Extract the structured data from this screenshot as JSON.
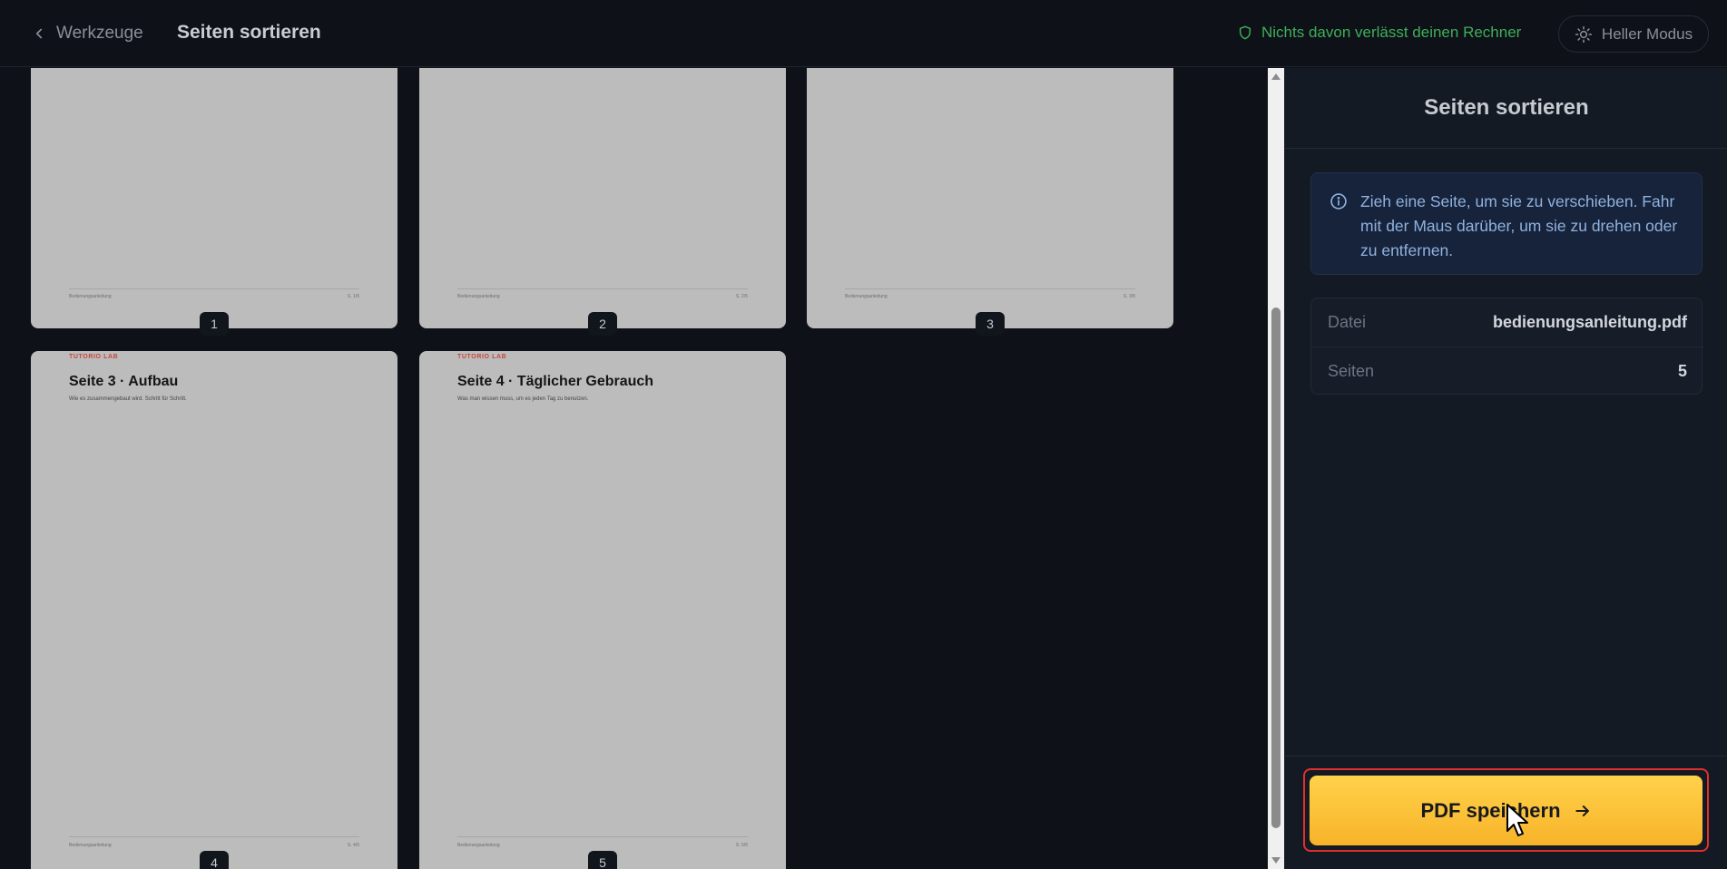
{
  "header": {
    "back_label": "Werkzeuge",
    "title": "Seiten sortieren",
    "privacy_text": "Nichts davon verlässt deinen Rechner",
    "theme_label": "Heller Modus"
  },
  "pages": [
    {
      "number": "1",
      "footer_left": "Bedienungsanleitung",
      "footer_right": "S. 1/5"
    },
    {
      "number": "2",
      "footer_left": "Bedienungsanleitung",
      "footer_right": "S. 2/5"
    },
    {
      "number": "3",
      "footer_left": "Bedienungsanleitung",
      "footer_right": "S. 3/5"
    },
    {
      "number": "4",
      "brand": "TUTORIO LAB",
      "heading": "Seite 3 · Aufbau",
      "subtitle": "Wie es zusammengebaut wird. Schritt für Schritt.",
      "footer_left": "Bedienungsanleitung",
      "footer_right": "S. 4/5"
    },
    {
      "number": "5",
      "brand": "TUTORIO LAB",
      "heading": "Seite 4 · Täglicher Gebrauch",
      "subtitle": "Was man wissen muss, um es jeden Tag zu benutzen.",
      "footer_left": "Bedienungsanleitung",
      "footer_right": "S. 5/5"
    }
  ],
  "panel": {
    "title": "Seiten sortieren",
    "info_text": "Zieh eine Seite, um sie zu verschieben. Fahr mit der Maus darüber, um sie zu drehen oder zu entfernen.",
    "file_label": "Datei",
    "file_value": "bedienungsanleitung.pdf",
    "pages_label": "Seiten",
    "pages_value": "5",
    "save_label": "PDF speichern"
  },
  "colors": {
    "accent": "#f7b32a",
    "privacy": "#3fae59",
    "highlight": "#e0302c"
  }
}
